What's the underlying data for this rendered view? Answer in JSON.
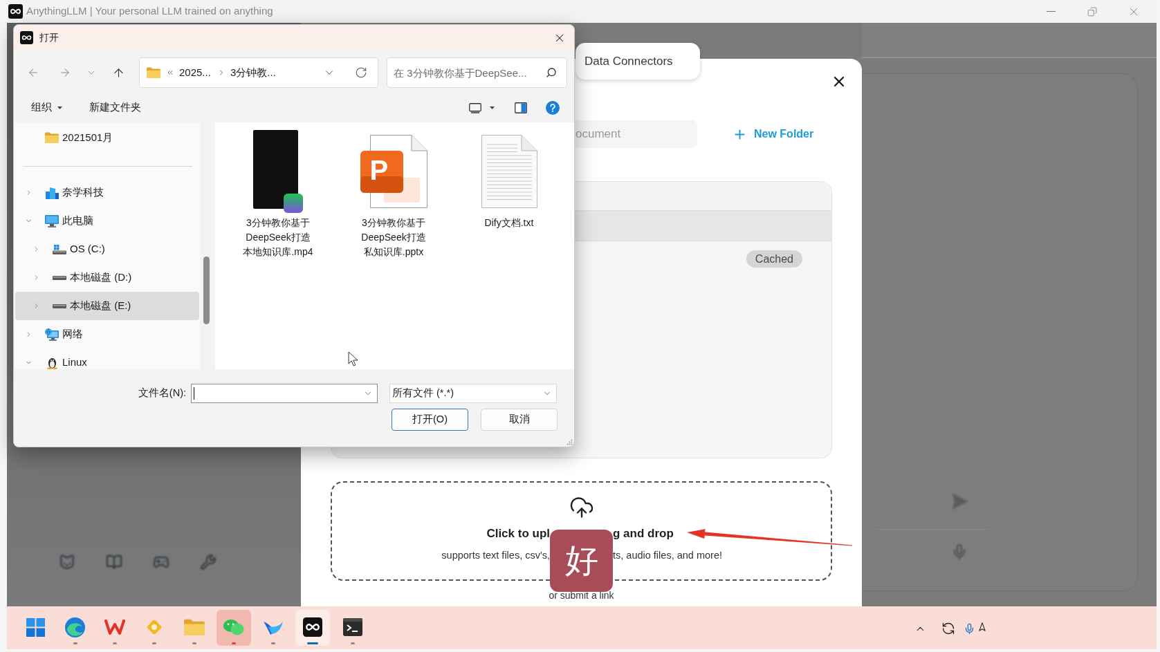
{
  "app_window": {
    "title": "AnythingLLM | Your personal LLM trained on anything"
  },
  "document_modal": {
    "tabs": [
      {
        "label": "Data Connectors",
        "selected": false
      }
    ],
    "search": {
      "placeholder": "ocument"
    },
    "new_folder_button": "New Folder",
    "file_list": {
      "status_badge": "Cached"
    },
    "upload": {
      "title_left": "Click to upl",
      "title_right": "g and drop",
      "hint_left": "supports text files, csv's,",
      "hint_right": "ts, audio files, and more!",
      "link": "or submit a link"
    }
  },
  "file_dialog": {
    "title": "打开",
    "address": {
      "crumbs": [
        "2025...",
        "3分钟教..."
      ]
    },
    "search": {
      "placeholder": "在 3分钟教你基于DeepSee..."
    },
    "commands": [
      {
        "label": "组织",
        "kind": "menu"
      },
      {
        "label": "新建文件夹",
        "kind": "button"
      }
    ],
    "quick_access": [
      {
        "label": "2021501月"
      }
    ],
    "tree": [
      {
        "label": "奈学科技",
        "kind": "cloud",
        "expanded": false,
        "selected": false
      },
      {
        "label": "此电脑",
        "kind": "pc",
        "expanded": true,
        "selected": false,
        "children": [
          {
            "label": "OS (C:)",
            "kind": "system_drive",
            "expanded": false,
            "selected": false
          },
          {
            "label": "本地磁盘 (D:)",
            "kind": "drive",
            "expanded": false,
            "selected": false
          },
          {
            "label": "本地磁盘 (E:)",
            "kind": "drive",
            "expanded": false,
            "selected": true
          }
        ]
      },
      {
        "label": "网络",
        "kind": "network",
        "expanded": false,
        "selected": false
      },
      {
        "label": "Linux",
        "kind": "linux",
        "expanded": true,
        "selected": false
      }
    ],
    "files": [
      {
        "name": "3分钟教你基于DeepSeek打造本地知识库.mp4",
        "kind": "video"
      },
      {
        "name": "3分钟教你基于DeepSeek打造私知识库.pptx",
        "kind": "slides",
        "icon_letter": "P"
      },
      {
        "name": "Dify文档.txt",
        "kind": "text"
      }
    ],
    "file_name": {
      "label": "文件名(N):"
    },
    "file_type": {
      "value": "所有文件 (*.*)"
    },
    "buttons": [
      {
        "label": "打开(O)",
        "default": true
      },
      {
        "label": "取消",
        "default": false
      }
    ]
  },
  "sticker": {
    "text": "好"
  },
  "taskbar": {
    "apps": [
      {
        "running": false,
        "attention": false,
        "selected": false
      },
      {
        "running": true,
        "attention": false,
        "selected": false
      },
      {
        "running": true,
        "attention": false,
        "selected": false
      },
      {
        "running": true,
        "attention": false,
        "selected": false
      },
      {
        "running": true,
        "attention": false,
        "selected": false
      },
      {
        "running": true,
        "attention": true,
        "selected": false
      },
      {
        "running": true,
        "attention": false,
        "selected": false
      },
      {
        "running": true,
        "attention": false,
        "selected": true
      },
      {
        "running": true,
        "attention": false,
        "selected": false
      }
    ]
  }
}
